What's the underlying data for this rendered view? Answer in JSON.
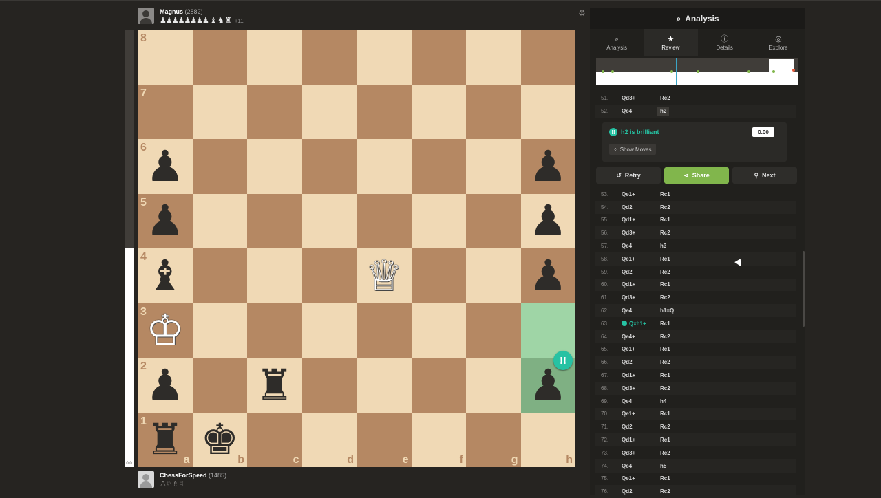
{
  "players": {
    "top": {
      "name": "Magnus",
      "rating": "(2882)",
      "captured": "♟♟♟♟♟♟♟♟ ♝ ♞ ♜",
      "advantage": "+11"
    },
    "bottom": {
      "name": "ChessForSpeed",
      "rating": "(1485)",
      "captured": "♙♘♗♖"
    }
  },
  "eval_bar": {
    "label": "0.0",
    "white_share": 0.5
  },
  "board": {
    "files": [
      "a",
      "b",
      "c",
      "d",
      "e",
      "f",
      "g",
      "h"
    ],
    "ranks": [
      "8",
      "7",
      "6",
      "5",
      "4",
      "3",
      "2",
      "1"
    ],
    "highlight_squares": [
      "h3",
      "h2"
    ],
    "pieces": [
      {
        "square": "a6",
        "glyph": "♟",
        "color": "black"
      },
      {
        "square": "h6",
        "glyph": "♟",
        "color": "black"
      },
      {
        "square": "a5",
        "glyph": "♟",
        "color": "black"
      },
      {
        "square": "h5",
        "glyph": "♟",
        "color": "black"
      },
      {
        "square": "a4",
        "glyph": "♝",
        "color": "black"
      },
      {
        "square": "e4",
        "glyph": "♕",
        "color": "white"
      },
      {
        "square": "h4",
        "glyph": "♟",
        "color": "black"
      },
      {
        "square": "a3",
        "glyph": "♔",
        "color": "white"
      },
      {
        "square": "a2",
        "glyph": "♟",
        "color": "black"
      },
      {
        "square": "c2",
        "glyph": "♜",
        "color": "black"
      },
      {
        "square": "h2",
        "glyph": "♟",
        "color": "black"
      },
      {
        "square": "a1",
        "glyph": "♜",
        "color": "black"
      },
      {
        "square": "b1",
        "glyph": "♚",
        "color": "black"
      }
    ],
    "brilliant_badge": "!!"
  },
  "panel": {
    "title": "Analysis",
    "tabs": [
      {
        "label": "Analysis",
        "icon": "⌕"
      },
      {
        "label": "Review",
        "icon": "★"
      },
      {
        "label": "Details",
        "icon": "ⓘ"
      },
      {
        "label": "Explore",
        "icon": "◎"
      }
    ],
    "active_tab": "Review",
    "moves_top": [
      {
        "num": "51.",
        "white": "Qd3+",
        "black": "Rc2"
      },
      {
        "num": "52.",
        "white": "Qe4",
        "black": "h2",
        "selected": true
      }
    ],
    "feedback": {
      "badge": "!!",
      "text": "h2 is brilliant",
      "eval": "0.00",
      "show_moves": "Show Moves"
    },
    "buttons": {
      "retry": "Retry",
      "share": "Share",
      "next": "Next"
    },
    "moves": [
      {
        "num": "53.",
        "white": "Qe1+",
        "black": "Rc1"
      },
      {
        "num": "54.",
        "white": "Qd2",
        "black": "Rc2"
      },
      {
        "num": "55.",
        "white": "Qd1+",
        "black": "Rc1"
      },
      {
        "num": "56.",
        "white": "Qd3+",
        "black": "Rc2"
      },
      {
        "num": "57.",
        "white": "Qe4",
        "black": "h3"
      },
      {
        "num": "58.",
        "white": "Qe1+",
        "black": "Rc1"
      },
      {
        "num": "59.",
        "white": "Qd2",
        "black": "Rc2"
      },
      {
        "num": "60.",
        "white": "Qd1+",
        "black": "Rc1"
      },
      {
        "num": "61.",
        "white": "Qd3+",
        "black": "Rc2"
      },
      {
        "num": "62.",
        "white": "Qe4",
        "black": "h1=Q"
      },
      {
        "num": "63.",
        "white": "Qxh1+",
        "black": "Rc1",
        "brilliant": true
      },
      {
        "num": "64.",
        "white": "Qe4+",
        "black": "Rc2"
      },
      {
        "num": "65.",
        "white": "Qe1+",
        "black": "Rc1"
      },
      {
        "num": "66.",
        "white": "Qd2",
        "black": "Rc2"
      },
      {
        "num": "67.",
        "white": "Qd1+",
        "black": "Rc1"
      },
      {
        "num": "68.",
        "white": "Qd3+",
        "black": "Rc2"
      },
      {
        "num": "69.",
        "white": "Qe4",
        "black": "h4"
      },
      {
        "num": "70.",
        "white": "Qe1+",
        "black": "Rc1"
      },
      {
        "num": "71.",
        "white": "Qd2",
        "black": "Rc2"
      },
      {
        "num": "72.",
        "white": "Qd1+",
        "black": "Rc1"
      },
      {
        "num": "73.",
        "white": "Qd3+",
        "black": "Rc2"
      },
      {
        "num": "74.",
        "white": "Qe4",
        "black": "h5"
      },
      {
        "num": "75.",
        "white": "Qe1+",
        "black": "Rc1"
      },
      {
        "num": "76.",
        "white": "Qd2",
        "black": "Rc2"
      }
    ]
  },
  "colors": {
    "light_square": "#f0d9b5",
    "dark_square": "#b58863",
    "brilliant": "#26c2a3",
    "share": "#81b64c",
    "graph_cursor": "#3ba5c6"
  }
}
